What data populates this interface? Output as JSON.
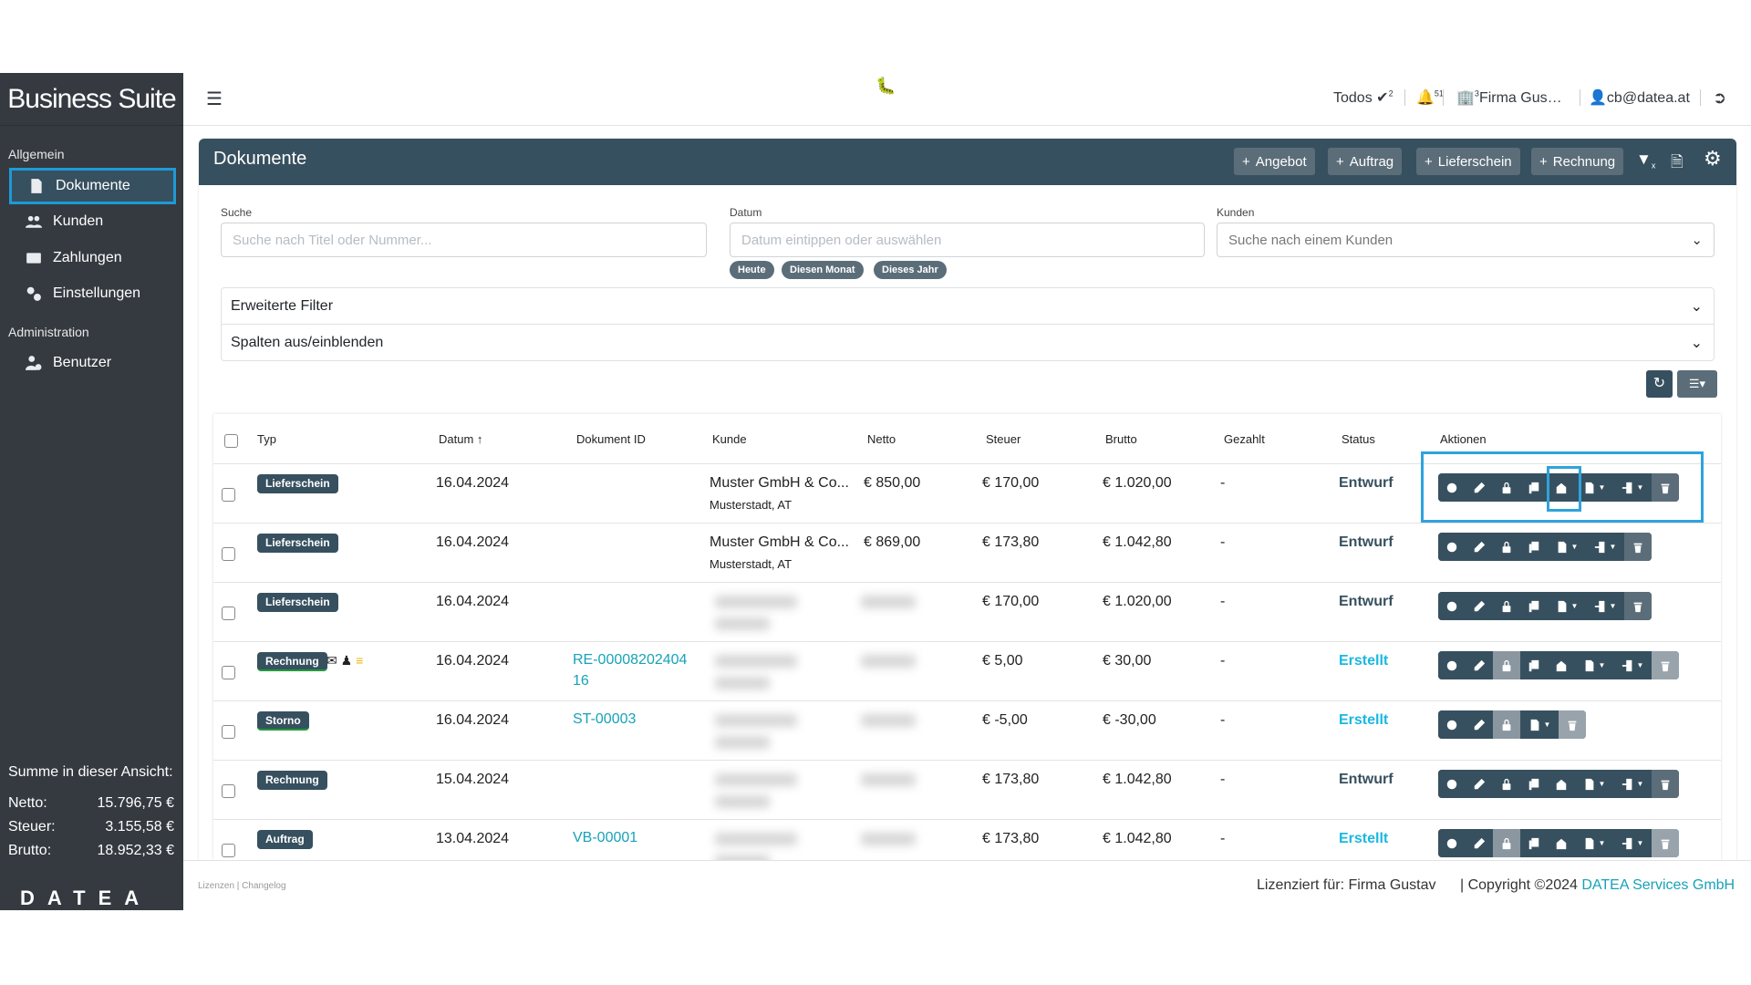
{
  "sidebar": {
    "brand": "Business Suite",
    "section_general": "Allgemein",
    "section_admin": "Administration",
    "items": [
      {
        "label": "Dokumente",
        "icon": "file-icon"
      },
      {
        "label": "Kunden",
        "icon": "users-icon"
      },
      {
        "label": "Zahlungen",
        "icon": "money-card-icon"
      },
      {
        "label": "Einstellungen",
        "icon": "gears-icon"
      },
      {
        "label": "Benutzer",
        "icon": "user-gear-icon"
      }
    ],
    "summary": {
      "title": "Summe in dieser Ansicht:",
      "netto_label": "Netto:",
      "netto": "15.796,75 €",
      "steuer_label": "Steuer:",
      "steuer": "3.155,58 €",
      "brutto_label": "Brutto:",
      "brutto": "18.952,33 €"
    },
    "logo": "DATEA"
  },
  "topbar": {
    "todos": "Todos",
    "todos_count": "2",
    "notifications_count": "51",
    "company": "Firma Gus…",
    "company_count": "3",
    "user": "cb@datea.at"
  },
  "card": {
    "title": "Dokumente",
    "buttons": [
      "Angebot",
      "Auftrag",
      "Lieferschein",
      "Rechnung"
    ]
  },
  "filters": {
    "search_label": "Suche",
    "search_placeholder": "Suche nach Titel oder Nummer...",
    "date_label": "Datum",
    "date_placeholder": "Datum eintippen oder auswählen",
    "chips": [
      "Heute",
      "Diesen Monat",
      "Dieses Jahr"
    ],
    "customer_label": "Kunden",
    "customer_placeholder": "Suche nach einem Kunden",
    "advanced": "Erweiterte Filter",
    "columns": "Spalten aus/einblenden"
  },
  "table": {
    "headers": [
      "Typ",
      "Datum",
      "Dokument ID",
      "Kunde",
      "Netto",
      "Steuer",
      "Brutto",
      "Gezahlt",
      "Status",
      "Aktionen"
    ],
    "rows": [
      {
        "typ": "Lieferschein",
        "datum": "16.04.2024",
        "id": "",
        "kunde": "Muster GmbH & Co...",
        "ort": "Musterstadt, AT",
        "netto": "€ 850,00",
        "steuer": "€ 170,00",
        "brutto": "€ 1.020,00",
        "gezahlt": "-",
        "status": "Entwurf",
        "actions": "full",
        "locked": false
      },
      {
        "typ": "Lieferschein",
        "datum": "16.04.2024",
        "id": "",
        "kunde": "Muster GmbH & Co...",
        "ort": "Musterstadt, AT",
        "netto": "€ 869,00",
        "steuer": "€ 173,80",
        "brutto": "€ 1.042,80",
        "gezahlt": "-",
        "status": "Entwurf",
        "actions": "nomail",
        "locked": false
      },
      {
        "typ": "Lieferschein",
        "datum": "16.04.2024",
        "id": "",
        "blurred": true,
        "steuer": "€ 170,00",
        "brutto": "€ 1.020,00",
        "gezahlt": "-",
        "status": "Entwurf",
        "actions": "nomail",
        "locked": false
      },
      {
        "typ": "Rechnung",
        "green": true,
        "icons": true,
        "datum": "16.04.2024",
        "id": "RE-00008202404 16",
        "blurred": true,
        "steuer": "€ 5,00",
        "brutto": "€ 30,00",
        "gezahlt": "-",
        "status": "Erstellt",
        "actions": "full",
        "locked": true
      },
      {
        "typ": "Storno",
        "green": true,
        "datum": "16.04.2024",
        "id": "ST-00003",
        "blurred": true,
        "steuer": "€ -5,00",
        "brutto": "€ -30,00",
        "gezahlt": "-",
        "status": "Erstellt",
        "actions": "storno",
        "locked": true
      },
      {
        "typ": "Rechnung",
        "datum": "15.04.2024",
        "id": "",
        "blurred": true,
        "steuer": "€ 173,80",
        "brutto": "€ 1.042,80",
        "gezahlt": "-",
        "status": "Entwurf",
        "actions": "full",
        "locked": false
      },
      {
        "typ": "Auftrag",
        "datum": "13.04.2024",
        "id": "VB-00001",
        "blurred": true,
        "steuer": "€ 173,80",
        "brutto": "€ 1.042,80",
        "gezahlt": "-",
        "status": "Erstellt",
        "actions": "full",
        "locked": true
      }
    ]
  },
  "footer": {
    "links": "Lizenzen | Changelog",
    "licensed": "Lizenziert für: Firma Gustav",
    "copyright": "| Copyright ©2024",
    "company": "DATEA Services GmbH"
  },
  "colors": {
    "sidebar": "#343a40",
    "header": "#37505f",
    "accent": "#1ab8e0",
    "highlight": "#2ea3dc"
  }
}
